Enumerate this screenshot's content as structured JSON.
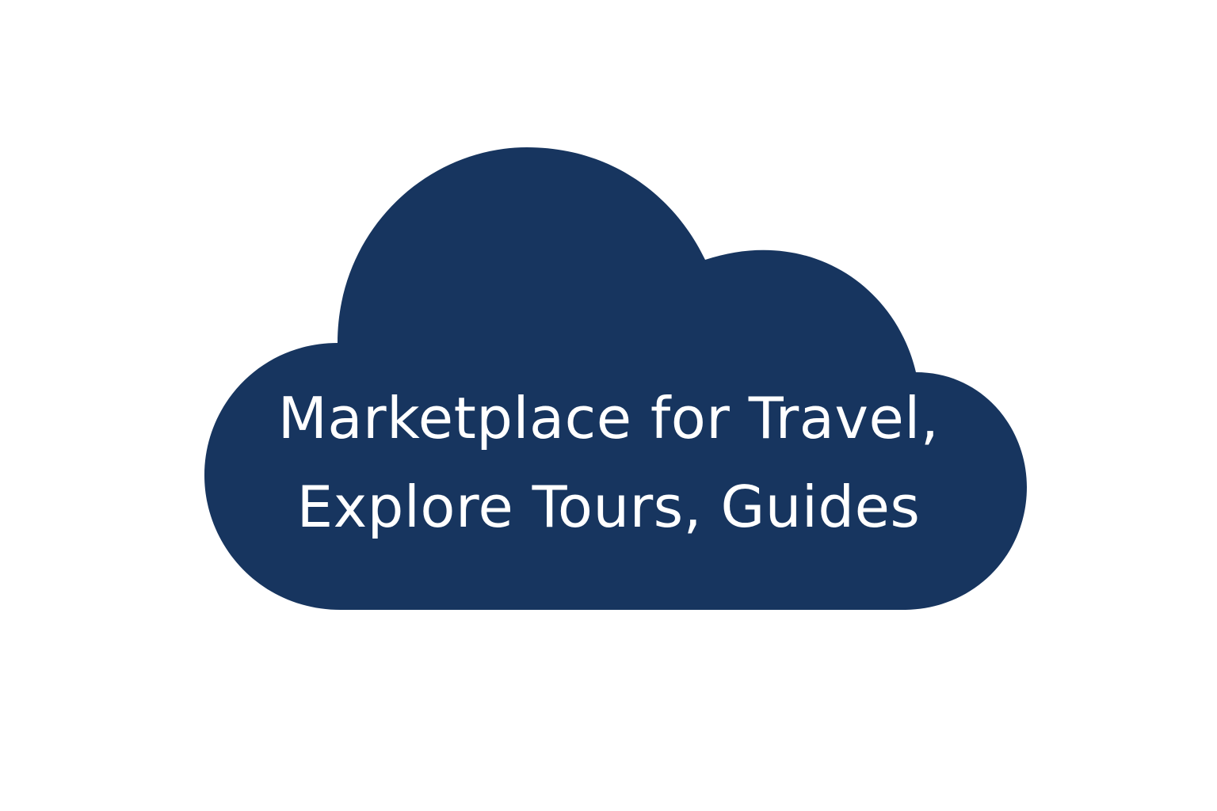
{
  "cloud": {
    "line1": "Marketplace for Travel,",
    "line2": "Explore Tours, Guides",
    "fill_color": "#17355f",
    "text_color": "#ffffff"
  },
  "background_color": "#ffffff"
}
